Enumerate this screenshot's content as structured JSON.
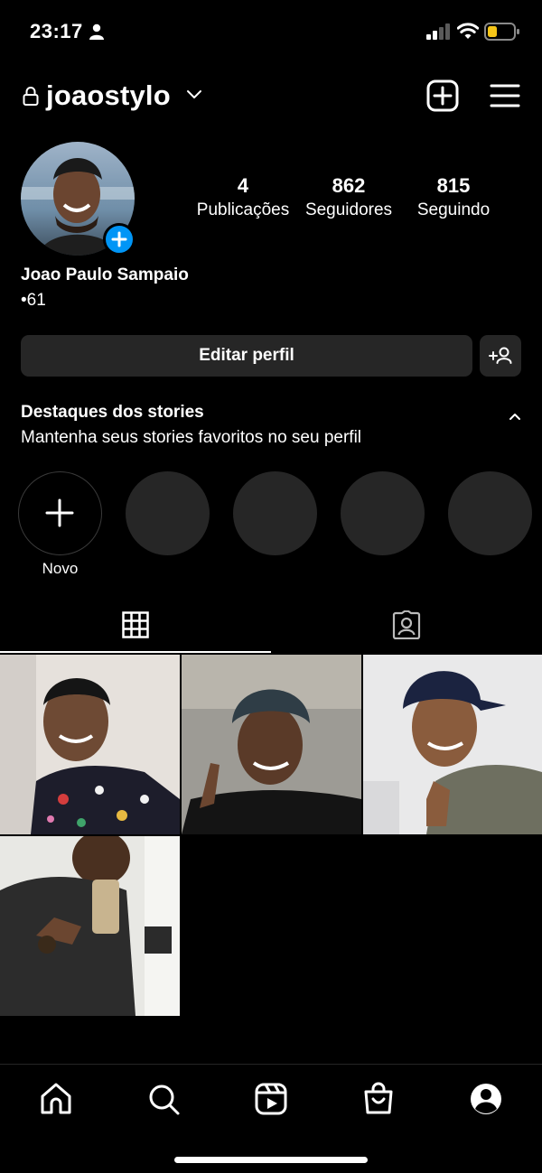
{
  "status_bar": {
    "time": "23:17",
    "icons": [
      "person-icon",
      "signal-icon",
      "wifi-icon",
      "battery-icon"
    ],
    "battery_color": "#f5c518"
  },
  "header": {
    "username": "joaostylo",
    "icons": [
      "lock-icon",
      "chevron-down-icon",
      "plus-square-icon",
      "menu-icon"
    ]
  },
  "profile": {
    "stats": [
      {
        "value": "4",
        "label": "Publicações"
      },
      {
        "value": "862",
        "label": "Seguidores"
      },
      {
        "value": "815",
        "label": "Seguindo"
      }
    ],
    "full_name": "Joao Paulo Sampaio",
    "bio": "•61",
    "edit_profile_label": "Editar perfil",
    "badge_color": "#0095f6"
  },
  "highlights": {
    "title": "Destaques dos stories",
    "subtitle": "Mantenha seus stories favoritos no seu perfil",
    "new_label": "Novo",
    "placeholder_count": 4
  },
  "tabs": [
    {
      "icon": "grid-icon",
      "active": true
    },
    {
      "icon": "tagged-icon",
      "active": false
    }
  ],
  "posts": [
    {
      "subject": "man smiling in floral shirt"
    },
    {
      "subject": "man with bike helmet making peace sign"
    },
    {
      "subject": "man in navy cap giving thumbs up"
    },
    {
      "subject": "mirror selfie with phone"
    }
  ],
  "bottom_nav": [
    "home-icon",
    "search-icon",
    "reels-icon",
    "shop-icon",
    "profile-icon"
  ],
  "colors": {
    "background": "#000000",
    "button_bg": "#262626",
    "accent": "#0095f6"
  }
}
